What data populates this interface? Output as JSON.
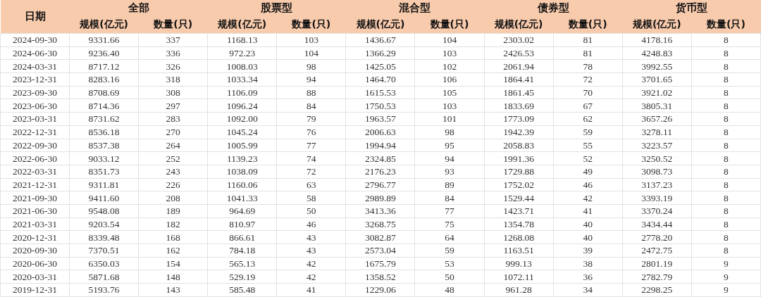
{
  "table": {
    "date_header": "日期",
    "groups": [
      {
        "title": "全部",
        "columns": [
          "规模(亿元)",
          "数量(只)"
        ]
      },
      {
        "title": "股票型",
        "columns": [
          "规模(亿元)",
          "数量(只)"
        ]
      },
      {
        "title": "混合型",
        "columns": [
          "规模(亿元)",
          "数量(只)"
        ]
      },
      {
        "title": "债券型",
        "columns": [
          "规模(亿元)",
          "数量(只)"
        ]
      },
      {
        "title": "货币型",
        "columns": [
          "规模(亿元)",
          "数量(只)"
        ]
      }
    ],
    "rows": [
      [
        "2024-09-30",
        "9331.66",
        "337",
        "1168.13",
        "103",
        "1436.67",
        "104",
        "2303.02",
        "81",
        "4178.16",
        "8"
      ],
      [
        "2024-06-30",
        "9236.40",
        "336",
        "972.23",
        "104",
        "1366.29",
        "103",
        "2426.53",
        "81",
        "4248.83",
        "8"
      ],
      [
        "2024-03-31",
        "8717.12",
        "326",
        "1008.03",
        "98",
        "1425.05",
        "102",
        "2061.94",
        "78",
        "3992.55",
        "8"
      ],
      [
        "2023-12-31",
        "8283.16",
        "318",
        "1033.34",
        "94",
        "1464.70",
        "106",
        "1864.41",
        "72",
        "3701.65",
        "8"
      ],
      [
        "2023-09-30",
        "8708.69",
        "308",
        "1106.09",
        "88",
        "1615.53",
        "105",
        "1861.45",
        "70",
        "3921.02",
        "8"
      ],
      [
        "2023-06-30",
        "8714.36",
        "297",
        "1096.24",
        "84",
        "1750.53",
        "103",
        "1833.69",
        "67",
        "3805.31",
        "8"
      ],
      [
        "2023-03-31",
        "8731.62",
        "283",
        "1092.00",
        "79",
        "1963.57",
        "101",
        "1773.09",
        "62",
        "3657.26",
        "8"
      ],
      [
        "2022-12-31",
        "8536.18",
        "270",
        "1045.24",
        "76",
        "2006.63",
        "98",
        "1942.39",
        "59",
        "3278.11",
        "8"
      ],
      [
        "2022-09-30",
        "8537.38",
        "264",
        "1005.99",
        "77",
        "1994.94",
        "95",
        "2058.83",
        "55",
        "3223.57",
        "8"
      ],
      [
        "2022-06-30",
        "9033.12",
        "252",
        "1139.23",
        "74",
        "2324.85",
        "94",
        "1991.36",
        "52",
        "3250.52",
        "8"
      ],
      [
        "2022-03-31",
        "8351.73",
        "243",
        "1038.09",
        "72",
        "2176.23",
        "93",
        "1729.88",
        "49",
        "3098.73",
        "8"
      ],
      [
        "2021-12-31",
        "9311.81",
        "226",
        "1160.06",
        "63",
        "2796.77",
        "89",
        "1752.02",
        "46",
        "3137.23",
        "8"
      ],
      [
        "2021-09-30",
        "9411.60",
        "208",
        "1041.33",
        "58",
        "2989.89",
        "84",
        "1529.44",
        "42",
        "3393.19",
        "8"
      ],
      [
        "2021-06-30",
        "9548.08",
        "189",
        "964.69",
        "50",
        "3413.36",
        "77",
        "1423.71",
        "41",
        "3370.24",
        "8"
      ],
      [
        "2021-03-31",
        "9203.54",
        "182",
        "810.97",
        "46",
        "3268.75",
        "75",
        "1354.78",
        "40",
        "3434.44",
        "8"
      ],
      [
        "2020-12-31",
        "8339.48",
        "168",
        "866.61",
        "43",
        "3082.87",
        "64",
        "1268.08",
        "40",
        "2778.20",
        "8"
      ],
      [
        "2020-09-30",
        "7370.51",
        "162",
        "784.18",
        "43",
        "2573.04",
        "59",
        "1163.51",
        "39",
        "2472.75",
        "8"
      ],
      [
        "2020-06-30",
        "6350.03",
        "154",
        "565.13",
        "42",
        "1675.79",
        "53",
        "999.13",
        "38",
        "2801.19",
        "9"
      ],
      [
        "2020-03-31",
        "5871.68",
        "148",
        "529.19",
        "42",
        "1358.52",
        "50",
        "1072.11",
        "36",
        "2782.79",
        "9"
      ],
      [
        "2019-12-31",
        "5193.76",
        "143",
        "585.48",
        "41",
        "1229.06",
        "48",
        "961.28",
        "34",
        "2298.25",
        "9"
      ]
    ]
  }
}
